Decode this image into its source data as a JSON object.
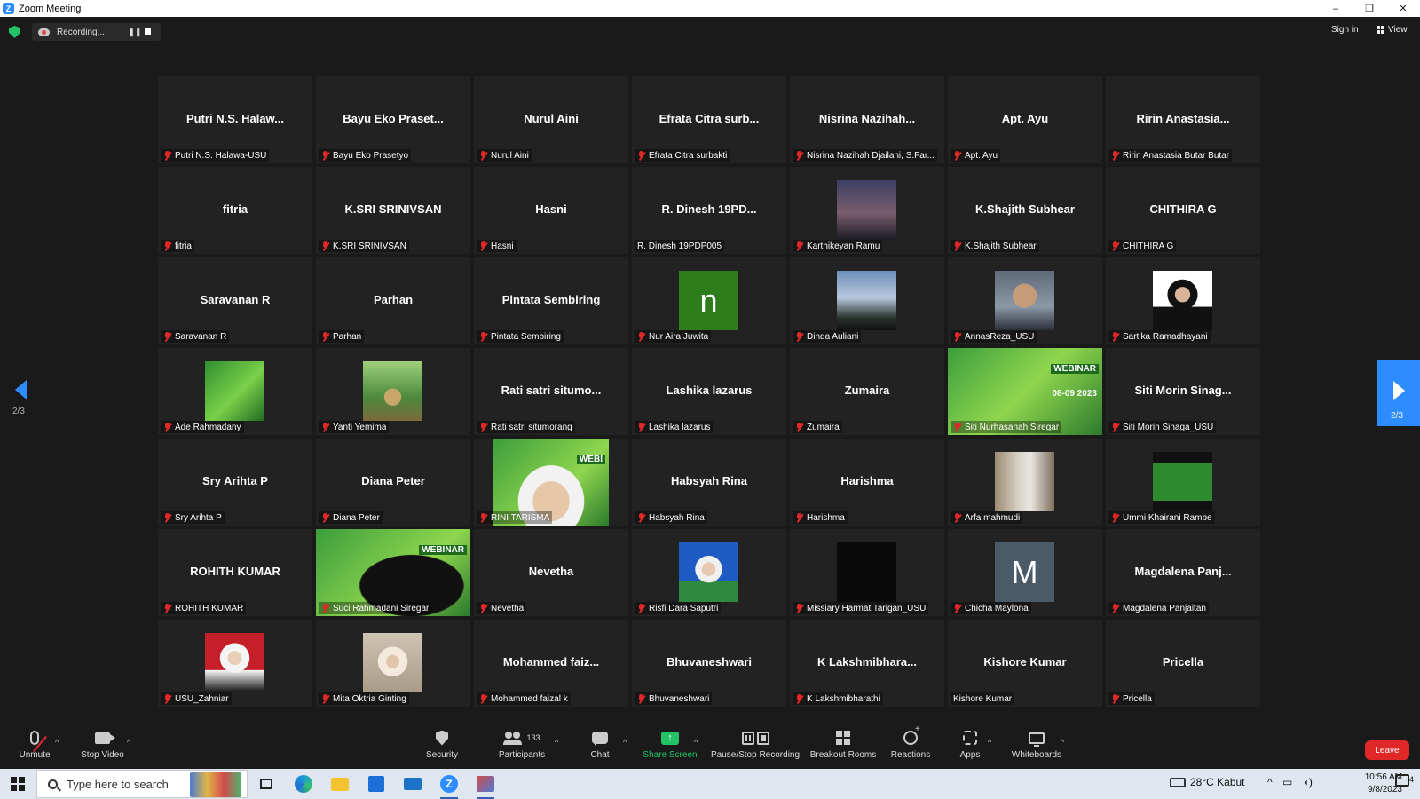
{
  "window": {
    "title": "Zoom Meeting",
    "minimize": "–",
    "restore": "❐",
    "close": "✕"
  },
  "topbar": {
    "recording_label": "Recording...",
    "pause": "❚❚",
    "sign_in": "Sign in",
    "view": "View"
  },
  "colors": {
    "accent": "#2d8cff",
    "share_green": "#23c266",
    "muted_red": "#e02828",
    "leave_red": "#e02828",
    "tile_bg": "#222222"
  },
  "tiles": [
    {
      "display": "Putri N.S. Halaw...",
      "label": "Putri N.S. Halawa-USU",
      "muted": true,
      "type": "name"
    },
    {
      "display": "Bayu Eko Praset...",
      "label": "Bayu Eko Prasetyo",
      "muted": true,
      "type": "name"
    },
    {
      "display": "Nurul Aini",
      "label": "Nurul Aini",
      "muted": true,
      "type": "name"
    },
    {
      "display": "Efrata Citra surb...",
      "label": "Efrata Citra surbakti",
      "muted": true,
      "type": "name"
    },
    {
      "display": "Nisrina Nazihah...",
      "label": "Nisrina Nazihah Djailani, S.Far...",
      "muted": true,
      "type": "name"
    },
    {
      "display": "Apt. Ayu",
      "label": "Apt. Ayu",
      "muted": true,
      "type": "name"
    },
    {
      "display": "Ririn Anastasia...",
      "label": "Ririn Anastasia Butar Butar",
      "muted": true,
      "type": "name"
    },
    {
      "display": "fitria",
      "label": "fitria",
      "muted": true,
      "type": "name"
    },
    {
      "display": "K.SRI SRINIVSAN",
      "label": "K.SRI SRINIVSAN",
      "muted": true,
      "type": "name"
    },
    {
      "display": "Hasni",
      "label": "Hasni",
      "muted": true,
      "type": "name"
    },
    {
      "display": "R. Dinesh 19PD...",
      "label": "R. Dinesh 19PDP005",
      "muted": false,
      "type": "name"
    },
    {
      "display": "",
      "label": "Karthikeyan Ramu",
      "muted": true,
      "type": "photo",
      "photo": "night-tower"
    },
    {
      "display": "K.Shajith Subhear",
      "label": "K.Shajith Subhear",
      "muted": true,
      "type": "name"
    },
    {
      "display": "CHITHIRA G",
      "label": "CHITHIRA G",
      "muted": true,
      "type": "name"
    },
    {
      "display": "Saravanan R",
      "label": "Saravanan R",
      "muted": true,
      "type": "name"
    },
    {
      "display": "Parhan",
      "label": "Parhan",
      "muted": true,
      "type": "name"
    },
    {
      "display": "Pintata Sembiring",
      "label": "Pintata Sembiring",
      "muted": true,
      "type": "name"
    },
    {
      "display": "",
      "label": "Nur Aira Juwita",
      "muted": true,
      "type": "avatar",
      "letter": "n",
      "avatar_color": "#2e7d1c"
    },
    {
      "display": "",
      "label": "Dinda Auliani",
      "muted": true,
      "type": "photo",
      "photo": "sky-trees"
    },
    {
      "display": "",
      "label": "AnnasReza_USU",
      "muted": true,
      "type": "photo",
      "photo": "portrait-man"
    },
    {
      "display": "",
      "label": "Sartika Ramadhayani",
      "muted": true,
      "type": "photo",
      "photo": "portrait-hijab-white"
    },
    {
      "display": "",
      "label": "Ade Rahmadany",
      "muted": true,
      "type": "photo",
      "photo": "green-banner"
    },
    {
      "display": "",
      "label": "Yanti Yemima",
      "muted": true,
      "type": "photo",
      "photo": "jungle-cat"
    },
    {
      "display": "Rati satri situmo...",
      "label": "Rati satri situmorang",
      "muted": true,
      "type": "name"
    },
    {
      "display": "Lashika lazarus",
      "label": "Lashika lazarus",
      "muted": true,
      "type": "name"
    },
    {
      "display": "Zumaira",
      "label": "Zumaira",
      "muted": true,
      "type": "name"
    },
    {
      "display": "",
      "label": "Siti Nurhasanah Siregar",
      "muted": true,
      "type": "video",
      "photo": "webinar-banner",
      "banner_text": "WEBINAR",
      "banner_date": "08-09 2023"
    },
    {
      "display": "Siti Morin Sinag...",
      "label": "Siti Morin Sinaga_USU",
      "muted": true,
      "type": "name"
    },
    {
      "display": "Sry Arihta P",
      "label": "Sry Arihta P",
      "muted": true,
      "type": "name"
    },
    {
      "display": "Diana Peter",
      "label": "Diana Peter",
      "muted": true,
      "type": "name"
    },
    {
      "display": "",
      "label": "RINI TARISMA",
      "muted": true,
      "type": "video",
      "photo": "webinar-face",
      "banner_text": "WEBI"
    },
    {
      "display": "Habsyah Rina",
      "label": "Habsyah Rina",
      "muted": true,
      "type": "name"
    },
    {
      "display": "Harishma",
      "label": "Harishma",
      "muted": true,
      "type": "name"
    },
    {
      "display": "",
      "label": "Arfa mahmudi",
      "muted": true,
      "type": "photo",
      "photo": "mirror-selfie"
    },
    {
      "display": "",
      "label": "Ummi Khairani Rambe",
      "muted": true,
      "type": "photo",
      "photo": "green-screen"
    },
    {
      "display": "ROHITH KUMAR",
      "label": "ROHITH KUMAR",
      "muted": true,
      "type": "name"
    },
    {
      "display": "",
      "label": "Suci Rahmadani Siregar",
      "muted": true,
      "type": "video",
      "photo": "webinar-person",
      "banner_text": "WEBINAR"
    },
    {
      "display": "Nevetha",
      "label": "Nevetha",
      "muted": true,
      "type": "name"
    },
    {
      "display": "",
      "label": "Risfi Dara Saputri",
      "muted": true,
      "type": "photo",
      "photo": "portrait-blue"
    },
    {
      "display": "",
      "label": "Missiary Harmat Tarigan_USU",
      "muted": true,
      "type": "photo",
      "photo": "black"
    },
    {
      "display": "",
      "label": "Chicha Maylona",
      "muted": true,
      "type": "avatar",
      "letter": "M",
      "avatar_color": "#4a5a66"
    },
    {
      "display": "Magdalena Panj...",
      "label": "Magdalena Panjaitan",
      "muted": true,
      "type": "name"
    },
    {
      "display": "",
      "label": "USU_Zahniar",
      "muted": true,
      "type": "photo",
      "photo": "portrait-red"
    },
    {
      "display": "",
      "label": "Mita Oktria Ginting",
      "muted": true,
      "type": "photo",
      "photo": "portrait-hijab-beige"
    },
    {
      "display": "Mohammed faiz...",
      "label": "Mohammed faizal k",
      "muted": true,
      "type": "name"
    },
    {
      "display": "Bhuvaneshwari",
      "label": "Bhuvaneshwari",
      "muted": true,
      "type": "name"
    },
    {
      "display": "K Lakshmibhara...",
      "label": "K Lakshmibharathi",
      "muted": true,
      "type": "name"
    },
    {
      "display": "Kishore Kumar",
      "label": "Kishore Kumar",
      "muted": false,
      "type": "name"
    },
    {
      "display": "Pricella",
      "label": "Pricella",
      "muted": true,
      "type": "name"
    }
  ],
  "nav": {
    "left_page": "2/3",
    "right_page": "2/3"
  },
  "toolbar": {
    "unmute": "Unmute",
    "stop_video": "Stop Video",
    "security": "Security",
    "participants": "Participants",
    "participant_count": "133",
    "chat": "Chat",
    "share_screen": "Share Screen",
    "pause_stop_recording": "Pause/Stop Recording",
    "breakout_rooms": "Breakout Rooms",
    "reactions": "Reactions",
    "apps": "Apps",
    "whiteboards": "Whiteboards",
    "leave": "Leave",
    "caret": "^"
  },
  "taskbar": {
    "search_placeholder": "Type here to search",
    "weather": "28°C  Kabut",
    "time": "10:56 AM",
    "date": "9/8/2023",
    "notifications": "4"
  }
}
